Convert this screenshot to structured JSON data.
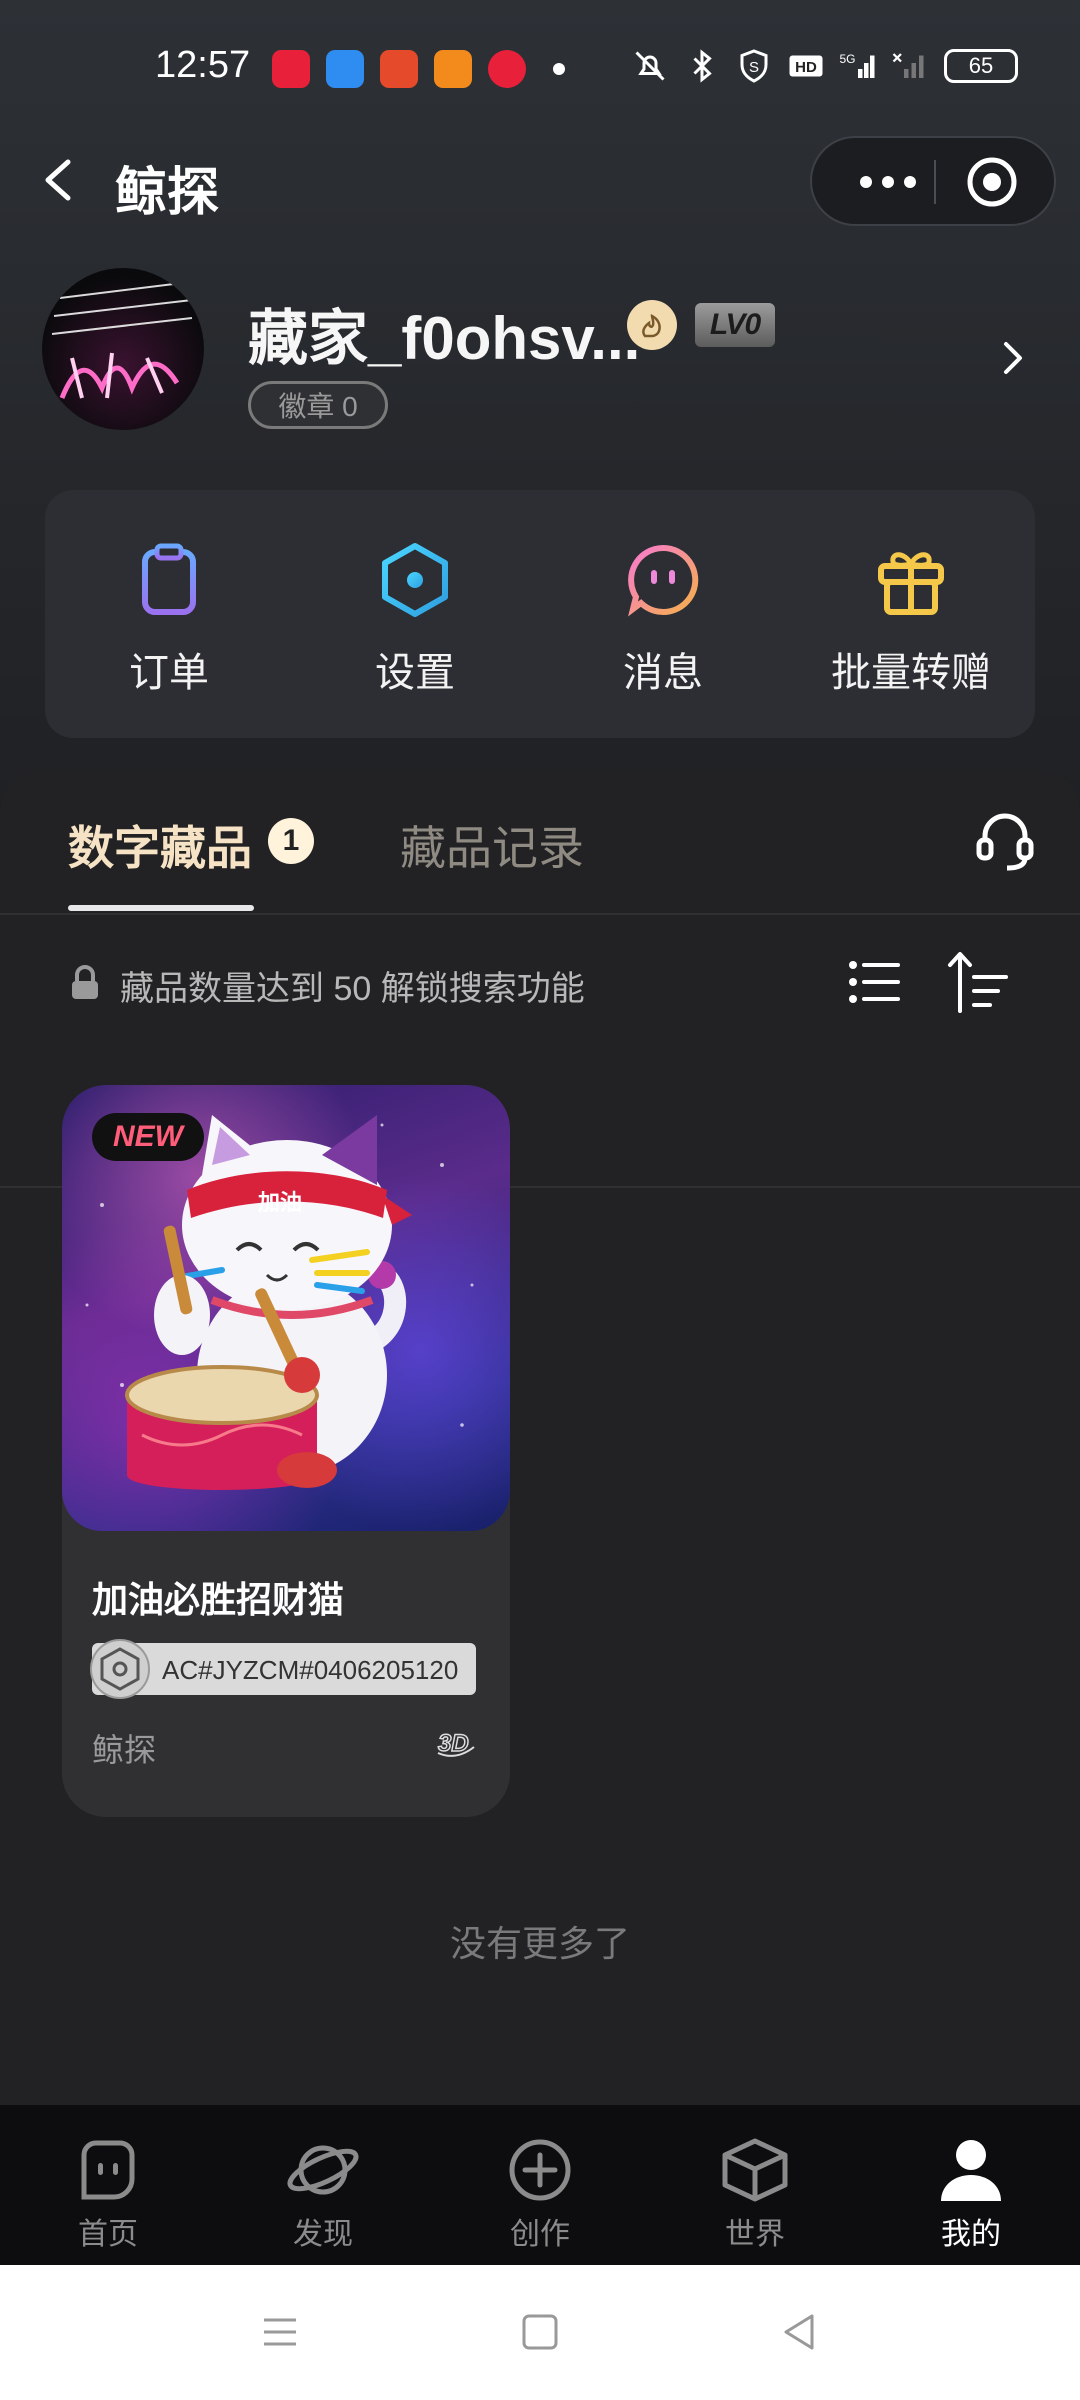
{
  "status_bar": {
    "time": "12:57",
    "battery": "65",
    "network": "5G"
  },
  "header": {
    "title": "鲸探"
  },
  "profile": {
    "username": "藏家_f0ohsv...",
    "level": "LV0",
    "medal_label": "徽章 0"
  },
  "menu": [
    {
      "label": "订单",
      "icon": "clipboard-icon"
    },
    {
      "label": "设置",
      "icon": "hexagon-settings-icon"
    },
    {
      "label": "消息",
      "icon": "chat-face-icon"
    },
    {
      "label": "批量转赠",
      "icon": "gift-icon"
    }
  ],
  "tabs": {
    "active_label": "数字藏品",
    "active_count": "1",
    "inactive_label": "藏品记录"
  },
  "hint": {
    "text": "藏品数量达到 50 解锁搜索功能"
  },
  "items": [
    {
      "badge": "NEW",
      "title": "加油必胜招财猫",
      "serial": "AC#JYZCM#0406205120",
      "brand": "鲸探",
      "headband_text": "加油"
    }
  ],
  "list_end_text": "没有更多了",
  "bottom_nav": [
    {
      "label": "首页",
      "icon": "home-face-icon",
      "active": false
    },
    {
      "label": "发现",
      "icon": "planet-icon",
      "active": false
    },
    {
      "label": "创作",
      "icon": "plus-circle-icon",
      "active": false
    },
    {
      "label": "世界",
      "icon": "cube-icon",
      "active": false
    },
    {
      "label": "我的",
      "icon": "person-icon",
      "active": true
    }
  ],
  "colors": {
    "tab_active": "#f6e2c4",
    "accent_gift": "#f5c84a",
    "accent_settings": "#3ec8f0",
    "accent_message": "#e57de0",
    "accent_order": "#8a7df5"
  }
}
